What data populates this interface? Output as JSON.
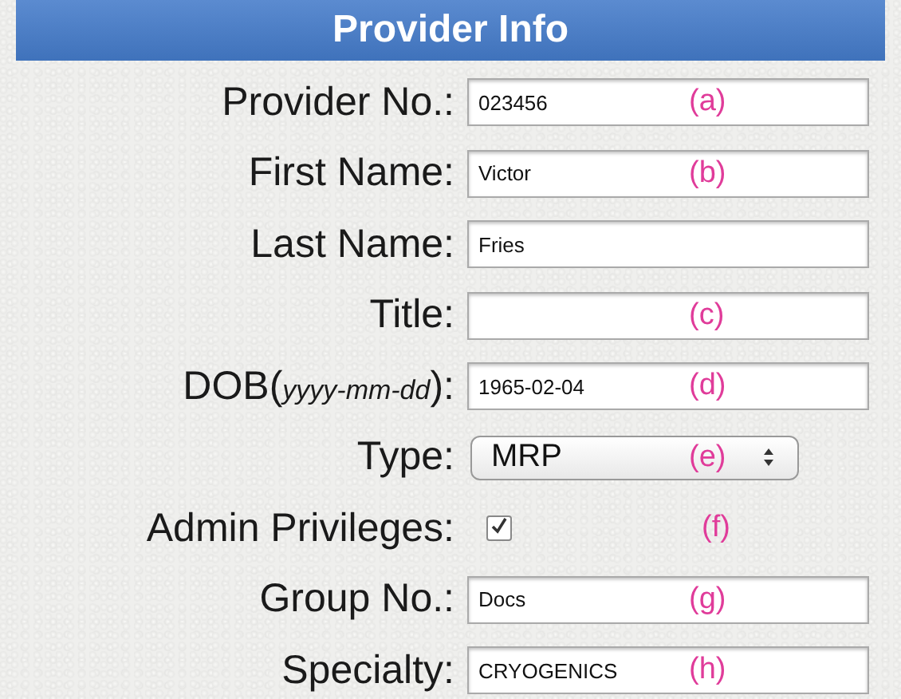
{
  "header": {
    "title": "Provider Info"
  },
  "fields": [
    {
      "kind": "text",
      "label": "Provider No.:",
      "value": "023456",
      "note": "(a)"
    },
    {
      "kind": "text",
      "label": "First Name:",
      "value": "Victor",
      "note": "(b)"
    },
    {
      "kind": "text",
      "label": "Last Name:",
      "value": "Fries"
    },
    {
      "kind": "text",
      "label": "Title:",
      "note": "(c)"
    },
    {
      "kind": "text",
      "label": "DOB(*yyyy-mm-dd*):",
      "value": "1965-02-04",
      "note": "(d)"
    },
    {
      "kind": "select",
      "label": "Type:",
      "value": "MRP",
      "note": "(e)"
    },
    {
      "kind": "checkbox",
      "label": "Admin Privileges:",
      "checked": true,
      "note": "(f)"
    },
    {
      "kind": "text",
      "label": "Group No.:",
      "value": "Docs",
      "note": "(g)"
    },
    {
      "kind": "text",
      "label": "Specialty:",
      "value": "CRYOGENICS",
      "note": "(h)"
    }
  ]
}
